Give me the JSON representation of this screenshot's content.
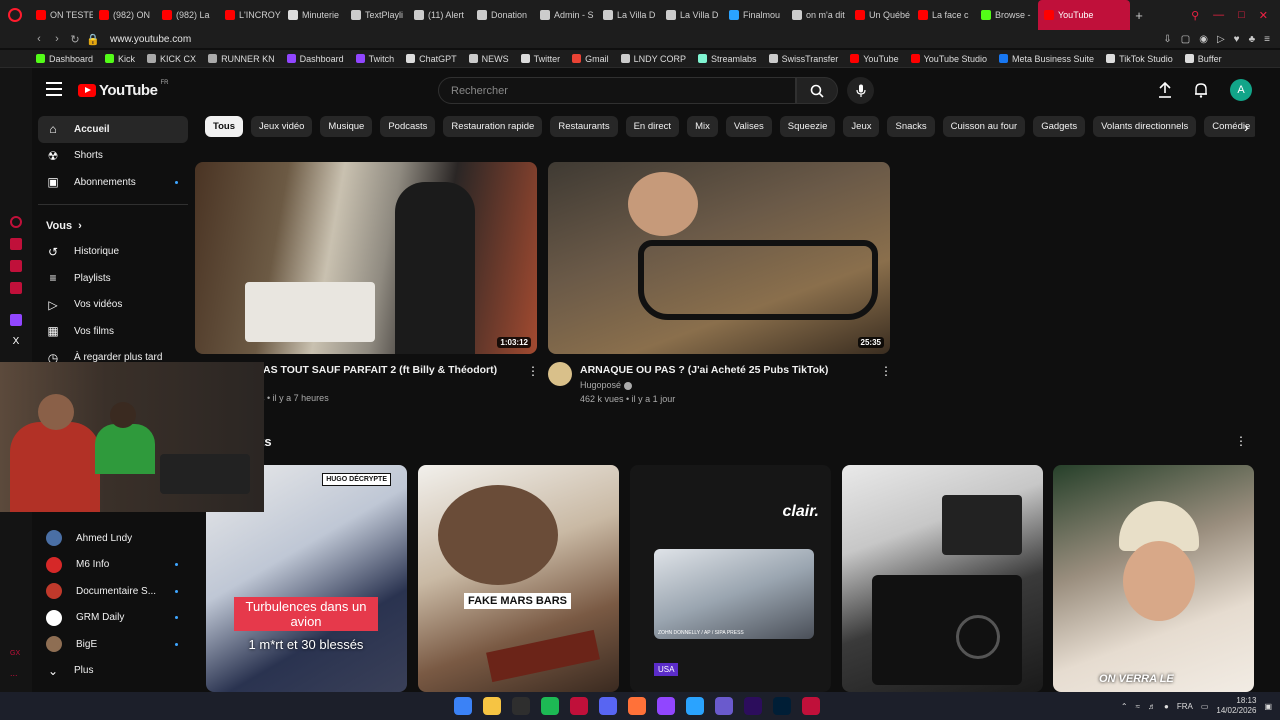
{
  "browser": {
    "tabs": [
      {
        "label": "ON TESTE",
        "color": "#ff0000"
      },
      {
        "label": "(982) ON",
        "color": "#ff0000"
      },
      {
        "label": "(982) La",
        "color": "#ff0000"
      },
      {
        "label": "L'INCROY",
        "color": "#ff0000"
      },
      {
        "label": "Minuterie",
        "color": "#dddddd"
      },
      {
        "label": "TextPlayli",
        "color": "#cccccc"
      },
      {
        "label": "(11) Alert",
        "color": "#cccccc"
      },
      {
        "label": "Donation",
        "color": "#cccccc"
      },
      {
        "label": "Admin - S",
        "color": "#cccccc"
      },
      {
        "label": "La Villa D",
        "color": "#cccccc"
      },
      {
        "label": "La Villa D",
        "color": "#cccccc"
      },
      {
        "label": "Finalmou",
        "color": "#2aa3ff"
      },
      {
        "label": "on m'a dit",
        "color": "#cccccc"
      },
      {
        "label": "Un Québé",
        "color": "#ff0000"
      },
      {
        "label": "La face c",
        "color": "#ff0000"
      },
      {
        "label": "Browse -",
        "color": "#53fc18"
      },
      {
        "label": "YouTube",
        "color": "#ff0000",
        "active": true
      }
    ],
    "url": "www.youtube.com",
    "bookmarks": [
      {
        "label": "Dashboard",
        "color": "#53fc18"
      },
      {
        "label": "Kick",
        "color": "#53fc18"
      },
      {
        "label": "KICK CX",
        "color": "#aaaaaa"
      },
      {
        "label": "RUNNER KN",
        "color": "#aaaaaa"
      },
      {
        "label": "Dashboard",
        "color": "#9146ff"
      },
      {
        "label": "Twitch",
        "color": "#9146ff"
      },
      {
        "label": "ChatGPT",
        "color": "#dddddd"
      },
      {
        "label": "NEWS",
        "color": "#cccccc"
      },
      {
        "label": "Twitter",
        "color": "#dddddd"
      },
      {
        "label": "Gmail",
        "color": "#ea4335"
      },
      {
        "label": "LNDY CORP",
        "color": "#cccccc"
      },
      {
        "label": "Streamlabs",
        "color": "#80f5d2"
      },
      {
        "label": "SwissTransfer",
        "color": "#cccccc"
      },
      {
        "label": "YouTube",
        "color": "#ff0000"
      },
      {
        "label": "YouTube Studio",
        "color": "#ff0000"
      },
      {
        "label": "Meta Business Suite",
        "color": "#1877f2"
      },
      {
        "label": "TikTok Studio",
        "color": "#dddddd"
      },
      {
        "label": "Buffer",
        "color": "#dddddd"
      }
    ]
  },
  "yt": {
    "logo_text": "YouTube",
    "country": "FR",
    "search_placeholder": "Rechercher",
    "avatar_letter": "A",
    "sidebar": {
      "main": [
        {
          "label": "Accueil",
          "icon": "home-icon",
          "active": true
        },
        {
          "label": "Shorts",
          "icon": "shorts-icon"
        },
        {
          "label": "Abonnements",
          "icon": "subscriptions-icon",
          "dot": true
        }
      ],
      "vous_title": "Vous",
      "vous": [
        {
          "label": "Historique",
          "icon": "history-icon"
        },
        {
          "label": "Playlists",
          "icon": "playlists-icon"
        },
        {
          "label": "Vos vidéos",
          "icon": "your-videos-icon"
        },
        {
          "label": "Vos films",
          "icon": "your-movies-icon"
        },
        {
          "label": "À regarder plus tard",
          "icon": "watch-later-icon"
        }
      ],
      "subs": [
        {
          "label": "Ahmed Lndy",
          "color": "#4a6fa5",
          "dot": false
        },
        {
          "label": "M6 Info",
          "color": "#d62828",
          "dot": true
        },
        {
          "label": "Documentaire S...",
          "color": "#c0392b",
          "dot": true
        },
        {
          "label": "GRM Daily",
          "color": "#ffffff",
          "dot": true
        },
        {
          "label": "BigE",
          "color": "#8e6e53",
          "dot": true
        }
      ],
      "more_label": "Plus"
    },
    "chips": [
      "Tous",
      "Jeux vidéo",
      "Musique",
      "Podcasts",
      "Restauration rapide",
      "Restaurants",
      "En direct",
      "Mix",
      "Valises",
      "Squeezie",
      "Jeux",
      "Snacks",
      "Cuisson au four",
      "Gadgets",
      "Volants directionnels",
      "Comédie"
    ],
    "videos": [
      {
        "title": "AS TOUT SAUF PARFAIT 2 (ft Billy & Théodort)",
        "meta": "es • il y a 7 heures",
        "duration": "1:03:12",
        "channel": ""
      },
      {
        "title": "ARNAQUE OU PAS ? (J'ai Acheté 25 Pubs TikTok)",
        "channel": "Hugoposé",
        "meta": "462 k vues • il y a 1 jour",
        "duration": "25:35"
      }
    ],
    "shorts_title": "ts",
    "shorts": [
      {
        "caption": "Turbulences dans un avion",
        "sub": "1 m*rt et 30 blessés",
        "badge": "HUGO DÉCRYPTE"
      },
      {
        "caption": "FAKE MARS BARS",
        "badge": ""
      },
      {
        "caption": "clair.",
        "tag": "USA",
        "photo_credit": "ZOHN DONNELLY / AP / SIPA PRESS"
      },
      {
        "caption": ""
      },
      {
        "caption": "ON VERRA LE"
      }
    ]
  },
  "taskbar": {
    "lang": "FRA",
    "time": "18:13",
    "date": "14/02/2026"
  },
  "colors": {
    "accent_browser": "#c0103a",
    "yt_red": "#ff0000",
    "bg": "#0f0f0f"
  }
}
